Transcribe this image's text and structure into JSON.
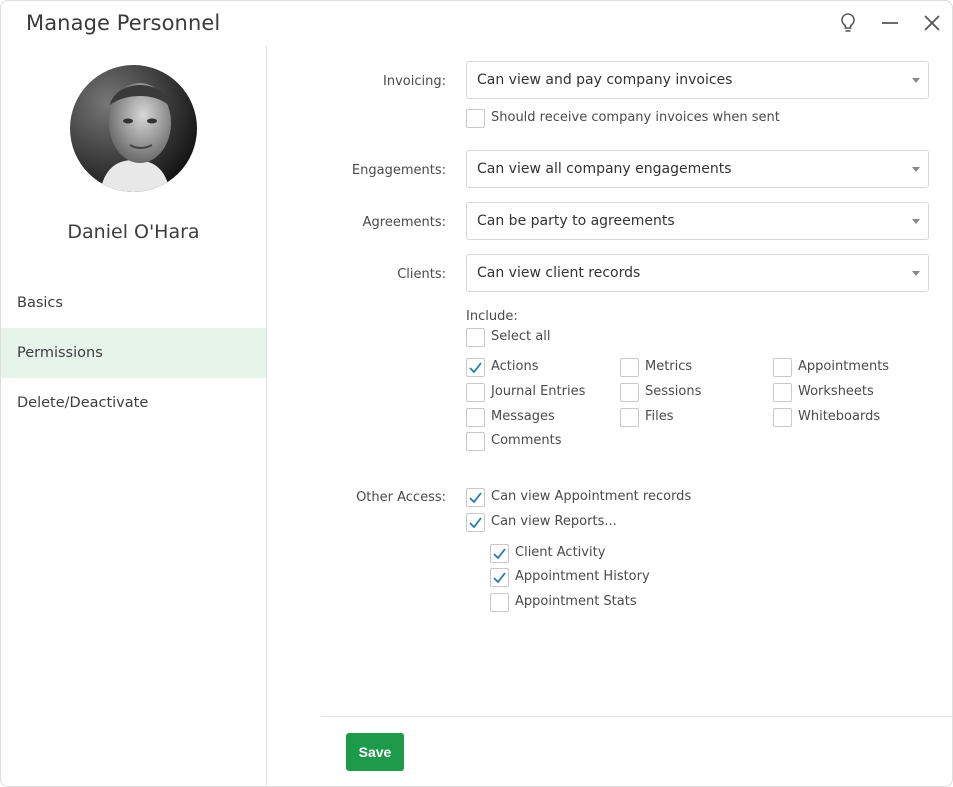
{
  "window": {
    "title": "Manage Personnel",
    "icons": {
      "tips": "lightbulb-icon",
      "minimize": "minimize-icon",
      "close": "close-icon"
    }
  },
  "profile": {
    "name": "Daniel O'Hara"
  },
  "sidebar": {
    "items": [
      {
        "label": "Basics",
        "active": false
      },
      {
        "label": "Permissions",
        "active": true
      },
      {
        "label": "Delete/Deactivate",
        "active": false
      }
    ]
  },
  "permissions": {
    "invoicing": {
      "label": "Invoicing:",
      "value": "Can view and pay company invoices"
    },
    "invoice_notify": {
      "label": "Should receive company invoices when sent",
      "checked": false
    },
    "engagements": {
      "label": "Engagements:",
      "value": "Can view all company engagements"
    },
    "agreements": {
      "label": "Agreements:",
      "value": "Can be party to agreements"
    },
    "clients": {
      "label": "Clients:",
      "value": "Can view client records"
    },
    "include": {
      "label": "Include:",
      "select_all": {
        "label": "Select all",
        "checked": false
      },
      "items": [
        {
          "label": "Actions",
          "checked": true
        },
        {
          "label": "Metrics",
          "checked": false
        },
        {
          "label": "Appointments",
          "checked": false
        },
        {
          "label": "Journal Entries",
          "checked": false
        },
        {
          "label": "Sessions",
          "checked": false
        },
        {
          "label": "Worksheets",
          "checked": false
        },
        {
          "label": "Messages",
          "checked": false
        },
        {
          "label": "Files",
          "checked": false
        },
        {
          "label": "Whiteboards",
          "checked": false
        },
        {
          "label": "Comments",
          "checked": false
        }
      ]
    },
    "other_access": {
      "label": "Other Access:",
      "items": [
        {
          "label": "Can view Appointment records",
          "checked": true
        },
        {
          "label": "Can view Reports...",
          "checked": true
        }
      ],
      "reports": [
        {
          "label": "Client Activity",
          "checked": true
        },
        {
          "label": "Appointment History",
          "checked": true
        },
        {
          "label": "Appointment Stats",
          "checked": false
        }
      ]
    }
  },
  "footer": {
    "save_label": "Save"
  },
  "colors": {
    "accent": "#1e9b4a",
    "active_nav": "#e6f4ea",
    "check": "#2a7bb0"
  }
}
